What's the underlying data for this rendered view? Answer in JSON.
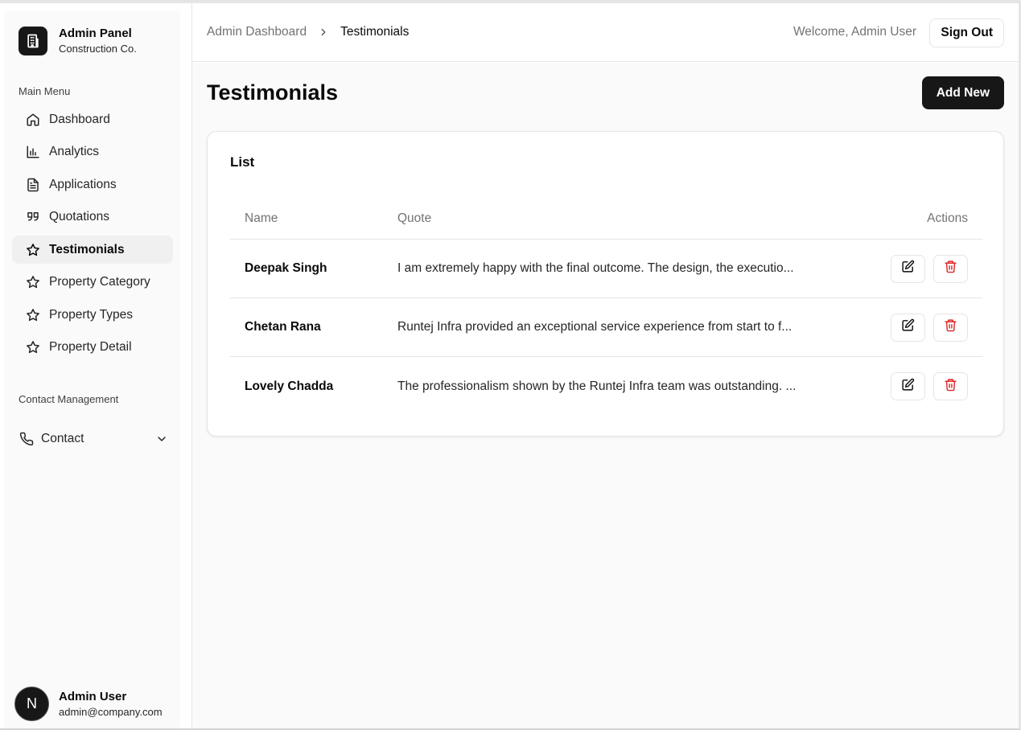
{
  "brand": {
    "title": "Admin Panel",
    "subtitle": "Construction Co."
  },
  "sidebar": {
    "main_menu_label": "Main Menu",
    "items": [
      {
        "label": "Dashboard",
        "icon": "home-icon"
      },
      {
        "label": "Analytics",
        "icon": "bar-chart-icon"
      },
      {
        "label": "Applications",
        "icon": "file-text-icon"
      },
      {
        "label": "Quotations",
        "icon": "quote-icon"
      },
      {
        "label": "Testimonials",
        "icon": "star-icon",
        "active": true
      },
      {
        "label": "Property Category",
        "icon": "star-icon"
      },
      {
        "label": "Property Types",
        "icon": "star-icon"
      },
      {
        "label": "Property Detail",
        "icon": "star-icon"
      }
    ],
    "contact_section_label": "Contact Management",
    "contact_item": {
      "label": "Contact",
      "icon": "phone-icon"
    }
  },
  "user": {
    "initial": "N",
    "name": "Admin User",
    "email": "admin@company.com"
  },
  "header": {
    "breadcrumb_home": "Admin Dashboard",
    "breadcrumb_current": "Testimonials",
    "welcome": "Welcome, Admin User",
    "sign_out": "Sign Out"
  },
  "page": {
    "title": "Testimonials",
    "add_new": "Add New"
  },
  "list": {
    "title": "List",
    "columns": {
      "name": "Name",
      "quote": "Quote",
      "actions": "Actions"
    },
    "rows": [
      {
        "name": "Deepak Singh",
        "quote": "I am extremely happy with the final outcome. The design, the executio..."
      },
      {
        "name": "Chetan Rana",
        "quote": "Runtej Infra provided an exceptional service experience from start to f..."
      },
      {
        "name": "Lovely Chadda",
        "quote": "The professionalism shown by the Runtej Infra team was outstanding. ..."
      }
    ]
  },
  "colors": {
    "primary": "#171717",
    "delete": "#dc2626",
    "border": "#e5e5e5",
    "muted": "#737373"
  }
}
